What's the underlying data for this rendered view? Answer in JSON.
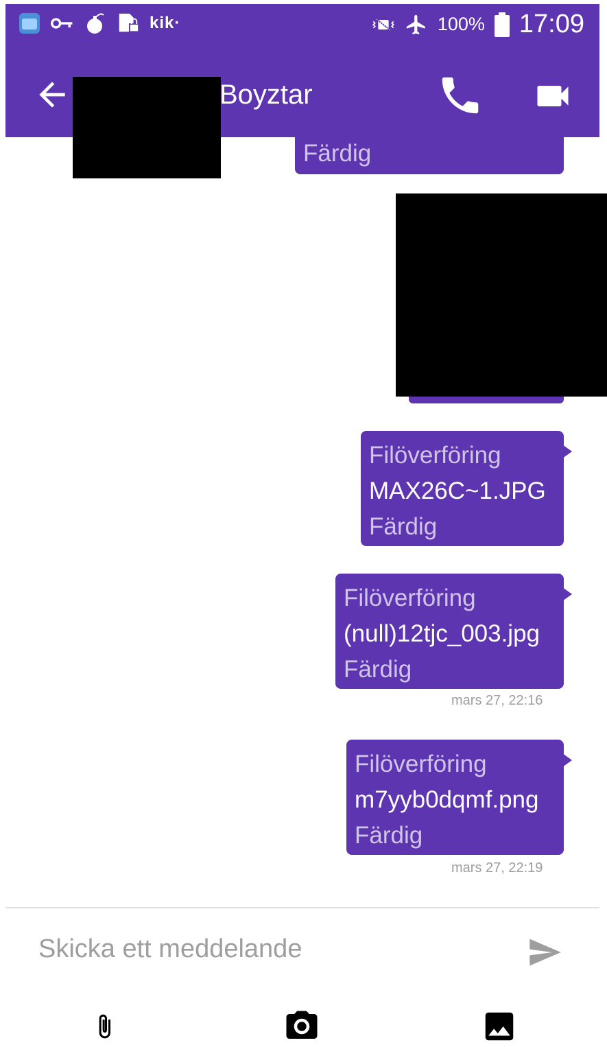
{
  "colors": {
    "primary": "#5e35b1",
    "label_text": "#d1c4e9",
    "timestamp": "#9e9e9e"
  },
  "status_bar": {
    "left_icons": [
      "app-icon",
      "key-icon",
      "bomb-icon",
      "sim-lock-icon"
    ],
    "kik_label": "kik·",
    "right_icons": [
      "vibrate-icon",
      "airplane-icon",
      "battery-icon"
    ],
    "battery_percent": "100%",
    "clock": "17:09"
  },
  "header": {
    "back_icon": "arrow-left-icon",
    "title": "Boyztar",
    "call_icon": "phone-icon",
    "video_icon": "video-camera-icon"
  },
  "messages": [
    {
      "status": "Färdig"
    },
    {
      "label": "Filöverföring",
      "filename": "MAX26C~1.JPG",
      "status": "Färdig"
    },
    {
      "label": "Filöverföring",
      "filename": "(null)12tjc_003.jpg",
      "status": "Färdig",
      "time": "mars 27, 22:16"
    },
    {
      "label": "Filöverföring",
      "filename": "m7yyb0dqmf.png",
      "status": "Färdig",
      "time": "mars 27, 22:19"
    }
  ],
  "composer": {
    "placeholder": "Skicka ett meddelande",
    "send_icon": "send-icon",
    "tools": [
      "paperclip-icon",
      "camera-icon",
      "image-icon"
    ]
  }
}
